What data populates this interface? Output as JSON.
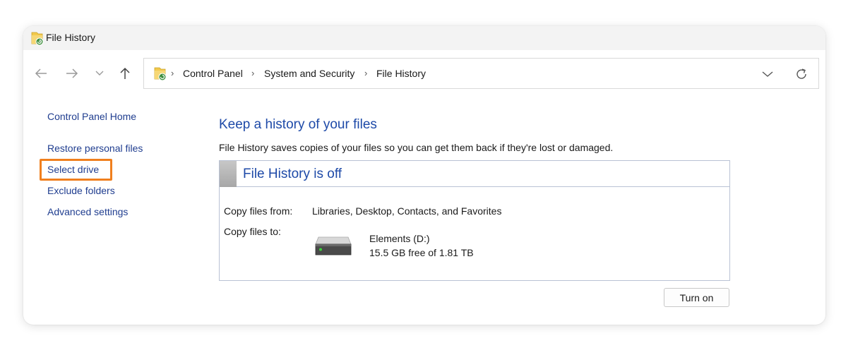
{
  "window": {
    "title": "File History"
  },
  "navigation": {
    "icons": [
      "back-arrow-icon",
      "forward-arrow-icon",
      "recent-locations-chevron-icon",
      "up-arrow-icon"
    ]
  },
  "address_bar": {
    "breadcrumbs": [
      "Control Panel",
      "System and Security",
      "File History"
    ],
    "separator": "›",
    "icons": [
      "file-history-folder-icon",
      "address-dropdown-icon",
      "refresh-icon"
    ]
  },
  "sidebar": {
    "home_link": "Control Panel Home",
    "links": [
      "Restore personal files",
      "Select drive",
      "Exclude folders",
      "Advanced settings"
    ],
    "highlighted": "Select drive"
  },
  "main": {
    "heading": "Keep a history of your files",
    "description": "File History saves copies of your files so you can get them back if they're lost or damaged.",
    "status_title": "File History is off",
    "copy_from_label": "Copy files from:",
    "copy_from_value": "Libraries, Desktop, Contacts, and Favorites",
    "copy_to_label": "Copy files to:",
    "drive_name": "Elements (D:)",
    "drive_space": "15.5 GB free of 1.81 TB",
    "turn_on_button": "Turn on"
  },
  "colors": {
    "link": "#1f3d8f",
    "heading": "#1e4aa8",
    "highlight_outline": "#f07f1e",
    "drive_led": "#3cd23c"
  }
}
